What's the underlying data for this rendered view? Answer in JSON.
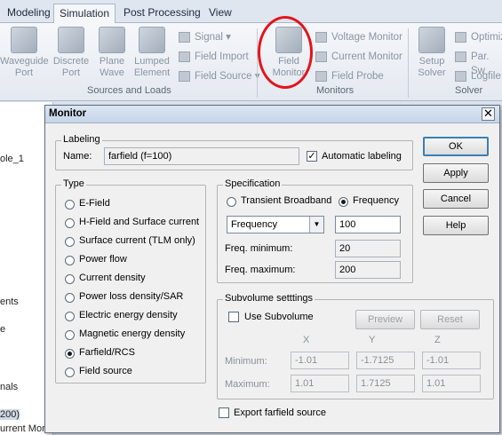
{
  "tabs": [
    "Modeling",
    "Simulation",
    "Post Processing",
    "View"
  ],
  "ribbon": {
    "waveguide": [
      "Waveguide",
      "Port"
    ],
    "discrete": [
      "Discrete",
      "Port"
    ],
    "plane_wave": [
      "Plane",
      "Wave"
    ],
    "lumped": [
      "Lumped",
      "Element"
    ],
    "signal": "Signal",
    "field_import": "Field Import",
    "field_source": "Field Source",
    "sources_group": "Sources and Loads",
    "field_monitor": [
      "Field",
      "Monitor"
    ],
    "voltage_monitor": "Voltage Monitor",
    "current_monitor": "Current Monitor",
    "field_probe": "Field Probe",
    "monitors_group": "Monitors",
    "setup_solver": [
      "Setup",
      "Solver"
    ],
    "optimize": "Optimiz",
    "par_sweep": "Par. Sw",
    "logfile": "Logfile",
    "solver_group": "Solver"
  },
  "left_panel": [
    "ole_1",
    "ents",
    "e",
    "nals",
    "200)",
    "urrent Mor"
  ],
  "dialog": {
    "title": "Monitor",
    "close": "✕",
    "labeling": {
      "legend": "Labeling",
      "name_label": "Name:",
      "name_value": "farfield (f=100)",
      "auto_label": "Automatic labeling",
      "auto_checked": true
    },
    "type": {
      "legend": "Type",
      "options": [
        "E-Field",
        "H-Field and Surface current",
        "Surface current (TLM only)",
        "Power flow",
        "Current density",
        "Power loss density/SAR",
        "Electric energy density",
        "Magnetic energy density",
        "Farfield/RCS",
        "Field source"
      ],
      "selected": "Farfield/RCS"
    },
    "specification": {
      "legend": "Specification",
      "transient": "Transient Broadband",
      "frequency": "Frequency",
      "selected": "Frequency",
      "dropdown": "Frequency",
      "value": "100",
      "freq_min_label": "Freq. minimum:",
      "freq_min": "20",
      "freq_max_label": "Freq. maximum:",
      "freq_max": "200"
    },
    "subvolume": {
      "legend": "Subvolume setttings",
      "use_label": "Use Subvolume",
      "preview": "Preview",
      "reset": "Reset",
      "x": "X",
      "y": "Y",
      "z": "Z",
      "minimum_label": "Minimum:",
      "maximum_label": "Maximum:",
      "min": [
        "-1.01",
        "-1.7125",
        "-1.01"
      ],
      "max": [
        "1.01",
        "1.7125",
        "1.01"
      ]
    },
    "export_label": "Export farfield source",
    "buttons": {
      "ok": "OK",
      "apply": "Apply",
      "cancel": "Cancel",
      "help": "Help"
    }
  }
}
